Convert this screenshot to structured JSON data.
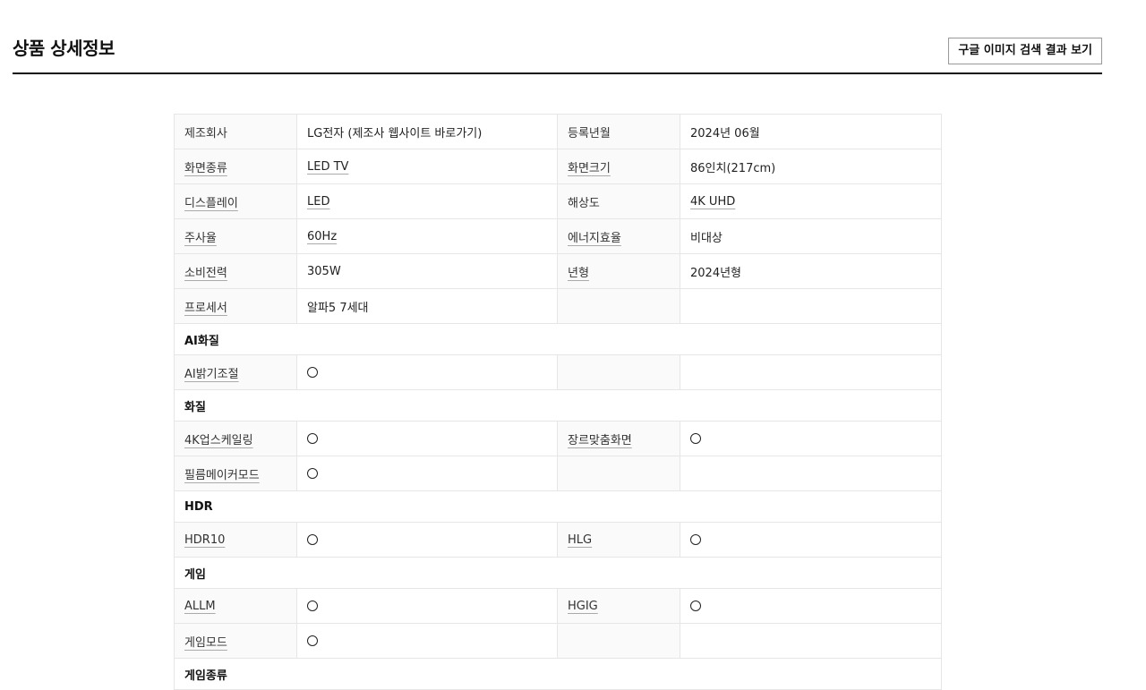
{
  "header": {
    "title": "상품 상세정보",
    "google_button": "구글 이미지 검색 결과 보기"
  },
  "rows": [
    {
      "type": "row",
      "cells": [
        {
          "label": "제조회사",
          "label_link": false,
          "value": "LG전자 (제조사 웹사이트 바로가기)",
          "value_link": false
        },
        {
          "label": "등록년월",
          "label_link": false,
          "value": "2024년 06월",
          "value_link": false
        }
      ]
    },
    {
      "type": "row",
      "cells": [
        {
          "label": "화면종류",
          "label_link": true,
          "value": "LED TV",
          "value_link": true
        },
        {
          "label": "화면크기",
          "label_link": true,
          "value": "86인치(217cm)",
          "value_link": false
        }
      ]
    },
    {
      "type": "row",
      "cells": [
        {
          "label": "디스플레이",
          "label_link": true,
          "value": "LED",
          "value_link": true
        },
        {
          "label": "해상도",
          "label_link": false,
          "value": "4K UHD",
          "value_link": true
        }
      ]
    },
    {
      "type": "row",
      "cells": [
        {
          "label": "주사율",
          "label_link": true,
          "value": "60Hz",
          "value_link": true
        },
        {
          "label": "에너지효율",
          "label_link": true,
          "value": "비대상",
          "value_link": false
        }
      ]
    },
    {
      "type": "row",
      "cells": [
        {
          "label": "소비전력",
          "label_link": true,
          "value": "305W",
          "value_link": false
        },
        {
          "label": "년형",
          "label_link": true,
          "value": "2024년형",
          "value_link": false
        }
      ]
    },
    {
      "type": "row",
      "cells": [
        {
          "label": "프로세서",
          "label_link": true,
          "value": "알파5 7세대",
          "value_link": false
        },
        {
          "label": "",
          "label_link": false,
          "value": "",
          "value_link": false
        }
      ]
    },
    {
      "type": "section",
      "title": "AI화질"
    },
    {
      "type": "row",
      "cells": [
        {
          "label": "AI밝기조절",
          "label_link": true,
          "value": "circle",
          "value_link": false
        },
        {
          "label": "",
          "label_link": false,
          "value": "",
          "value_link": false
        }
      ]
    },
    {
      "type": "section",
      "title": "화질"
    },
    {
      "type": "row",
      "cells": [
        {
          "label": "4K업스케일링",
          "label_link": true,
          "value": "circle",
          "value_link": false
        },
        {
          "label": "장르맞춤화면",
          "label_link": true,
          "value": "circle",
          "value_link": false
        }
      ]
    },
    {
      "type": "row",
      "cells": [
        {
          "label": "필름메이커모드",
          "label_link": true,
          "value": "circle",
          "value_link": false
        },
        {
          "label": "",
          "label_link": false,
          "value": "",
          "value_link": false
        }
      ]
    },
    {
      "type": "section",
      "title": "HDR"
    },
    {
      "type": "row",
      "cells": [
        {
          "label": "HDR10",
          "label_link": true,
          "value": "circle",
          "value_link": false
        },
        {
          "label": "HLG",
          "label_link": true,
          "value": "circle",
          "value_link": false
        }
      ]
    },
    {
      "type": "section",
      "title": "게임"
    },
    {
      "type": "row",
      "cells": [
        {
          "label": "ALLM",
          "label_link": true,
          "value": "circle",
          "value_link": false
        },
        {
          "label": "HGIG",
          "label_link": true,
          "value": "circle",
          "value_link": false
        }
      ]
    },
    {
      "type": "row",
      "cells": [
        {
          "label": "게임모드",
          "label_link": true,
          "value": "circle",
          "value_link": false
        },
        {
          "label": "",
          "label_link": false,
          "value": "",
          "value_link": false
        }
      ]
    },
    {
      "type": "section",
      "title": "게임종류"
    }
  ]
}
